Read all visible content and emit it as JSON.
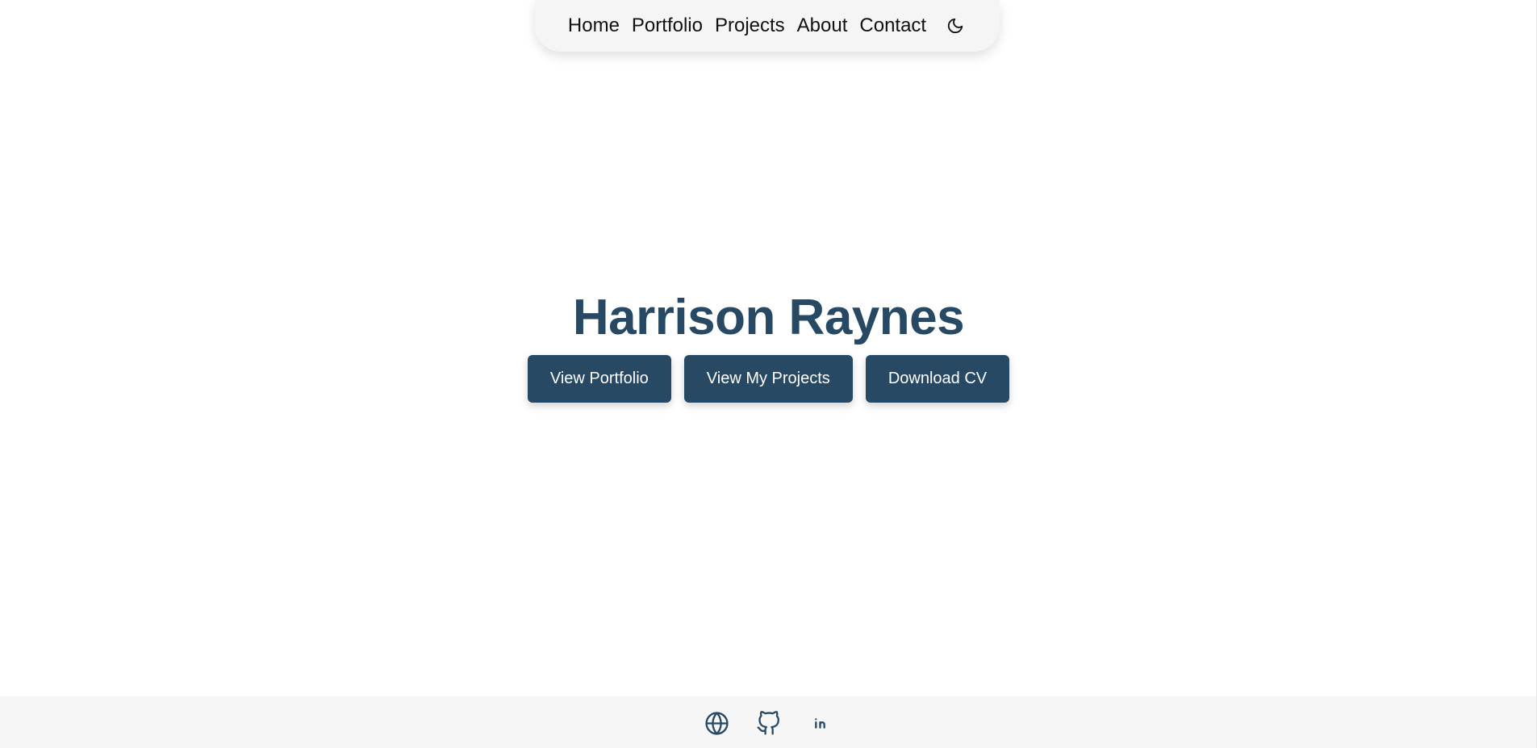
{
  "nav": {
    "items": [
      {
        "label": "Home"
      },
      {
        "label": "Portfolio"
      },
      {
        "label": "Projects"
      },
      {
        "label": "About"
      },
      {
        "label": "Contact"
      }
    ],
    "theme_toggle_icon": "moon-icon"
  },
  "hero": {
    "name": "Harrison Raynes",
    "buttons": [
      {
        "label": "View Portfolio"
      },
      {
        "label": "View My Projects"
      },
      {
        "label": "Download CV"
      }
    ]
  },
  "footer": {
    "links": [
      {
        "icon": "globe-icon"
      },
      {
        "icon": "github-icon"
      },
      {
        "icon": "linkedin-icon"
      }
    ]
  },
  "colors": {
    "accent": "#284963",
    "nav_background": "#f5f5f5",
    "footer_background": "#f6f6f6",
    "page_background": "#ffffff"
  }
}
